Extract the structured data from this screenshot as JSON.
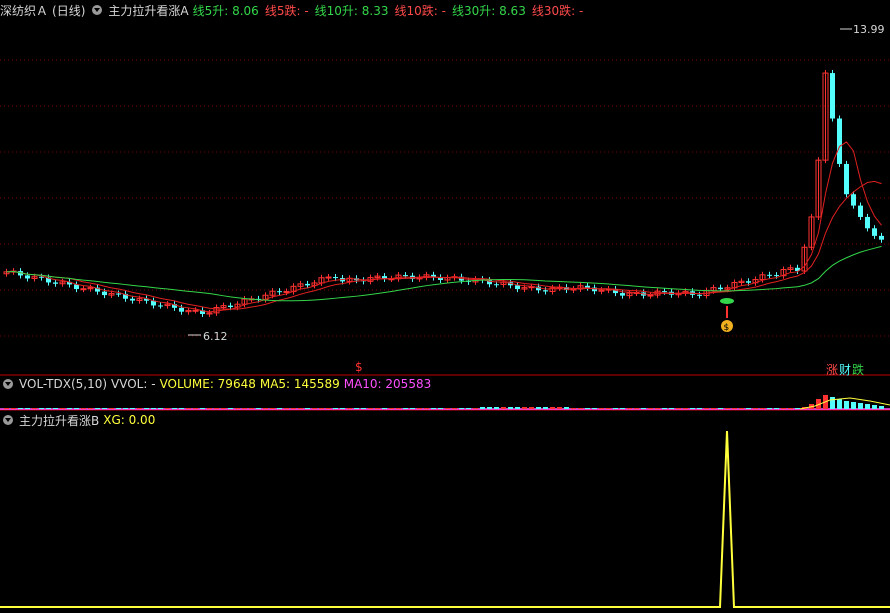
{
  "main_panel": {
    "stock_name": "深纺织Ａ",
    "period": "(日线)",
    "indicator_name": "主力拉升看涨A",
    "lines": [
      {
        "label": "线5升:",
        "value": "8.06",
        "color": "#34d64a"
      },
      {
        "label": "线5跌:",
        "value": "-",
        "color": "#ff4a4a"
      },
      {
        "label": "线10升:",
        "value": "8.33",
        "color": "#34d64a"
      },
      {
        "label": "线10跌:",
        "value": "-",
        "color": "#ff4a4a"
      },
      {
        "label": "线30升:",
        "value": "8.63",
        "color": "#34d64a"
      },
      {
        "label": "线30跌:",
        "value": "-",
        "color": "#ff4a4a"
      }
    ],
    "high_label": "13.99",
    "low_label": "6.12",
    "dollar_marker": "$",
    "legend_rise": "涨",
    "legend_fall": "跌",
    "legend_mid": "财",
    "money_label": "$"
  },
  "volume_panel": {
    "name": "VOL-TDX(5,10)",
    "vvol": "VVOL: -",
    "volume": "VOLUME: 79648",
    "ma5": "MA5: 145589",
    "ma10": "MA10: 205583"
  },
  "signal_panel": {
    "name": "主力拉升看涨B",
    "xg": "XG: 0.00"
  },
  "colors": {
    "up": "#ff3232",
    "down": "#54ffff",
    "ma_green": "#34d64a",
    "ma_red": "#e02020",
    "signal": "#ffff3c",
    "grid": "#7a0000"
  },
  "chart_data": {
    "type": "candlestick",
    "price_high": 13.99,
    "price_low": 6.12,
    "current": {
      "line5_up": 8.06,
      "line10_up": 8.33,
      "line30_up": 8.63
    },
    "volume": {
      "VOLUME": 79648,
      "MA5": 145589,
      "MA10": 205583
    },
    "signal": {
      "XG": 0.0
    }
  }
}
